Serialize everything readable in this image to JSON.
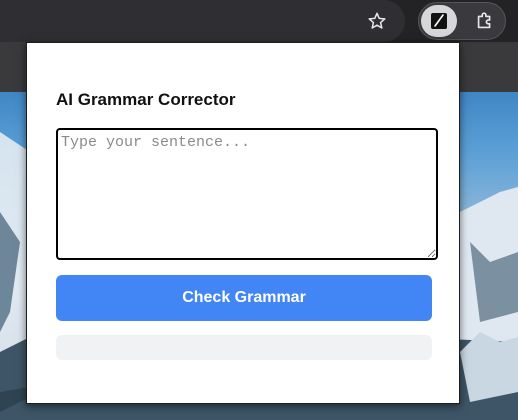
{
  "toolbar": {
    "bookmark_icon": "star-icon",
    "extension_icon": "pen-icon",
    "extensions_menu_icon": "puzzle-icon"
  },
  "popup": {
    "title": "AI Grammar Corrector",
    "input": {
      "placeholder": "Type your sentence...",
      "value": ""
    },
    "check_button_label": "Check Grammar",
    "result_text": ""
  },
  "colors": {
    "accent": "#4285f4",
    "result_bg": "#f1f2f4"
  }
}
